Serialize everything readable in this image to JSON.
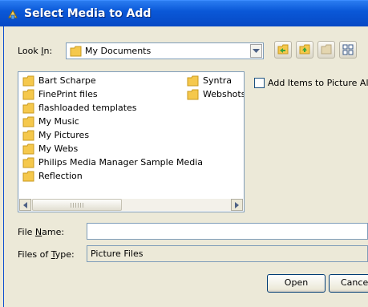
{
  "window": {
    "title": "Select Media to Add"
  },
  "look_in": {
    "label_pre": "Look ",
    "label_u": "I",
    "label_post": "n:",
    "value": "My Documents",
    "toolbar_icons": [
      "back-icon",
      "up-folder-icon",
      "new-folder-icon",
      "view-menu-icon"
    ]
  },
  "file_list": {
    "col1": [
      "Bart Scharpe",
      "FinePrint files",
      "flashloaded templates",
      "My Music",
      "My Pictures",
      "My Webs",
      "Philips Media Manager Sample Media",
      "Reflection"
    ],
    "col2": [
      "Syntra",
      "Webshots"
    ]
  },
  "add_items": {
    "label": "Add Items to Picture Albu",
    "checked": false
  },
  "file_name": {
    "label_pre": "File ",
    "label_u": "N",
    "label_post": "ame:",
    "value": ""
  },
  "file_type": {
    "label_pre": "Files of ",
    "label_u": "T",
    "label_post": "ype:",
    "value": "Picture Files"
  },
  "buttons": {
    "open": "Open",
    "cancel": "Cancel"
  },
  "colors": {
    "titlebar": "#0a58d8",
    "folder": "#f5c84c",
    "dialog_bg": "#ece9d8"
  }
}
